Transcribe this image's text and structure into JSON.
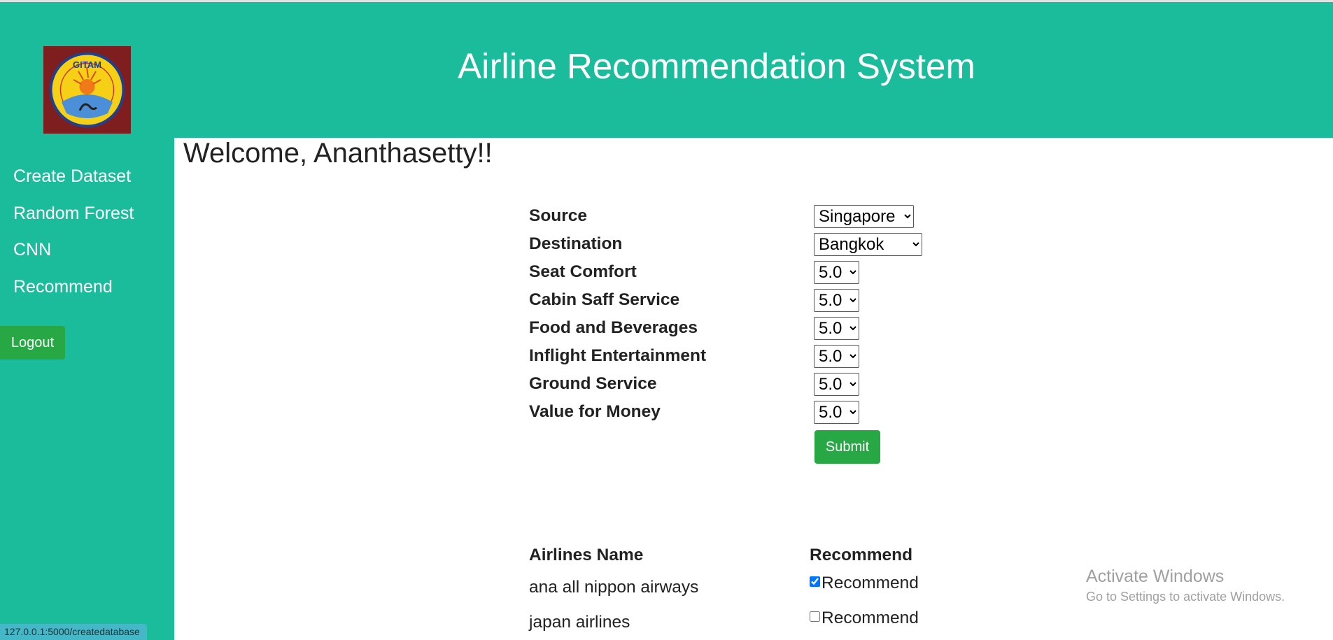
{
  "header": {
    "title": "Airline Recommendation System"
  },
  "sidebar": {
    "logo_text": "GITAM",
    "items": [
      {
        "label": "Create Dataset"
      },
      {
        "label": "Random Forest"
      },
      {
        "label": "CNN"
      },
      {
        "label": "Recommend"
      }
    ],
    "logout_label": "Logout"
  },
  "main": {
    "welcome": "Welcome, Ananthasetty!!",
    "form": {
      "fields": [
        {
          "label": "Source",
          "value": "Singapore"
        },
        {
          "label": "Destination",
          "value": "Bangkok"
        },
        {
          "label": "Seat Comfort",
          "value": "5.0"
        },
        {
          "label": "Cabin Saff Service",
          "value": "5.0"
        },
        {
          "label": "Food and Beverages",
          "value": "5.0"
        },
        {
          "label": "Inflight Entertainment",
          "value": "5.0"
        },
        {
          "label": "Ground Service",
          "value": "5.0"
        },
        {
          "label": "Value for Money",
          "value": "5.0"
        }
      ],
      "submit_label": "Submit"
    },
    "results": {
      "headers": [
        "Airlines Name",
        "Recommend"
      ],
      "rows": [
        {
          "name": "ana all nippon airways",
          "recommend_label": "Recommend",
          "checked": true
        },
        {
          "name": "japan airlines",
          "recommend_label": "Recommend",
          "checked": false
        }
      ]
    }
  },
  "status_bar": {
    "url": "127.0.0.1:5000/createdatabase"
  },
  "watermark": {
    "line1": "Activate Windows",
    "line2": "Go to Settings to activate Windows."
  },
  "colors": {
    "accent": "#1abc9c",
    "button": "#28a745",
    "logo_bg": "#7f1e1f"
  }
}
